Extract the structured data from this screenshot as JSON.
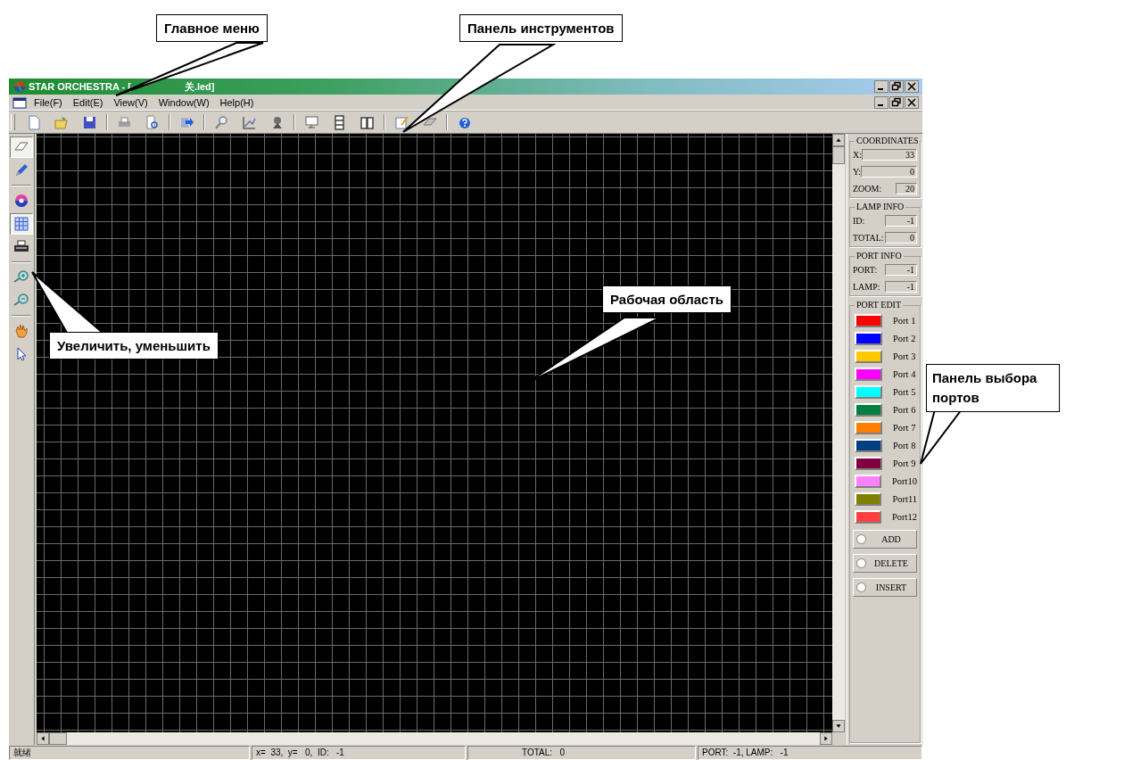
{
  "callouts": [
    {
      "kind": "menu",
      "text": "Главное меню"
    },
    {
      "kind": "toolbar",
      "text": "Панель инструментов"
    },
    {
      "kind": "zoom",
      "text": "Увеличить, уменьшить"
    },
    {
      "kind": "work",
      "text": "Рабочая область"
    },
    {
      "kind": "ports",
      "text": "Панель выбора портов"
    }
  ],
  "window": {
    "title_parts": [
      "STAR ORCHESTRA - [",
      "关.led]"
    ]
  },
  "menu": [
    "File(F)",
    "Edit(E)",
    "View(V)",
    "Window(W)",
    "Help(H)"
  ],
  "left_tools": [
    {
      "pressed": true
    },
    {
      "pressed": false
    },
    {
      "pressed": false
    },
    {
      "pressed": true
    },
    {
      "pressed": false
    },
    {
      "pressed": false
    },
    {
      "pressed": false
    },
    {
      "pressed": false
    },
    {
      "pressed": false
    }
  ],
  "panel": {
    "groups": [
      {
        "title": "COORDINATES",
        "fields": [
          {
            "label": "X:",
            "value": "33",
            "kind": "wide"
          },
          {
            "label": "Y:",
            "value": "0",
            "kind": "wide"
          },
          {
            "label": "ZOOM:",
            "value": "20",
            "kind": "narrow"
          }
        ]
      },
      {
        "title": "LAMP INFO",
        "fields": [
          {
            "label": "ID:",
            "value": "-1",
            "kind": "mid"
          },
          {
            "label": "TOTAL:",
            "value": "0",
            "kind": "mid"
          }
        ]
      },
      {
        "title": "PORT INFO",
        "fields": [
          {
            "label": "PORT:",
            "value": "-1",
            "kind": "mid"
          },
          {
            "label": "LAMP:",
            "value": "-1",
            "kind": "mid"
          }
        ]
      }
    ],
    "port_edit": {
      "title": "PORT EDIT",
      "ports": [
        {
          "label": "Port 1",
          "color": "#ff0000"
        },
        {
          "label": "Port 2",
          "color": "#0000ff"
        },
        {
          "label": "Port 3",
          "color": "#ffc800"
        },
        {
          "label": "Port 4",
          "color": "#ff00ff"
        },
        {
          "label": "Port 5",
          "color": "#00ffff"
        },
        {
          "label": "Port 6",
          "color": "#008040"
        },
        {
          "label": "Port 7",
          "color": "#ff8000"
        },
        {
          "label": "Port 8",
          "color": "#004080"
        },
        {
          "label": "Port 9",
          "color": "#800040"
        },
        {
          "label": "Port10",
          "color": "#ff80ff"
        },
        {
          "label": "Port11",
          "color": "#808000"
        },
        {
          "label": "Port12",
          "color": "#ff4040"
        }
      ],
      "modes": [
        {
          "label": "ADD",
          "selected": false
        },
        {
          "label": "DELETE",
          "selected": false
        },
        {
          "label": "INSERT",
          "selected": false
        }
      ]
    }
  },
  "status_bar": [
    "就绪",
    "x=  33,  y=   0,  ID:   -1",
    "TOTAL:   0",
    "PORT:  -1, LAMP:   -1"
  ]
}
